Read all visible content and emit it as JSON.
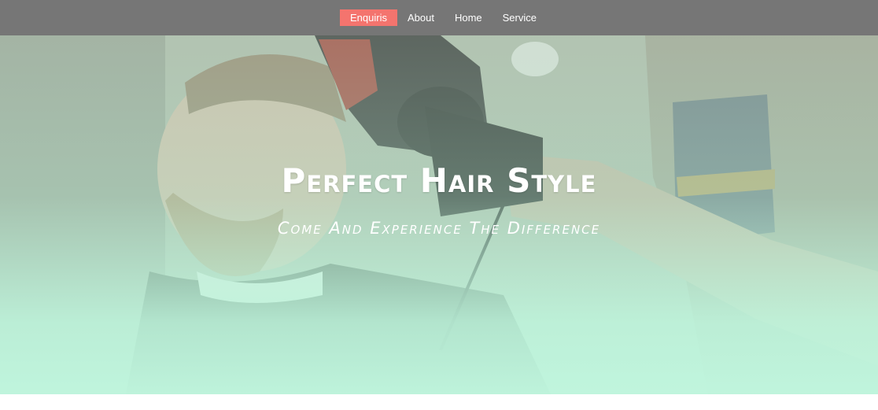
{
  "nav": {
    "items": [
      {
        "label": "Enquiris",
        "active": true
      },
      {
        "label": "About",
        "active": false
      },
      {
        "label": "Home",
        "active": false
      },
      {
        "label": "Service",
        "active": false
      }
    ],
    "active_color": "#f4746e",
    "bar_color": "#767676"
  },
  "hero": {
    "title": "Perfect Hair Style",
    "subtitle": "Come And Experience The Difference",
    "image": "barber-styling-hair-photo",
    "overlay_color": "#bff2d6"
  }
}
